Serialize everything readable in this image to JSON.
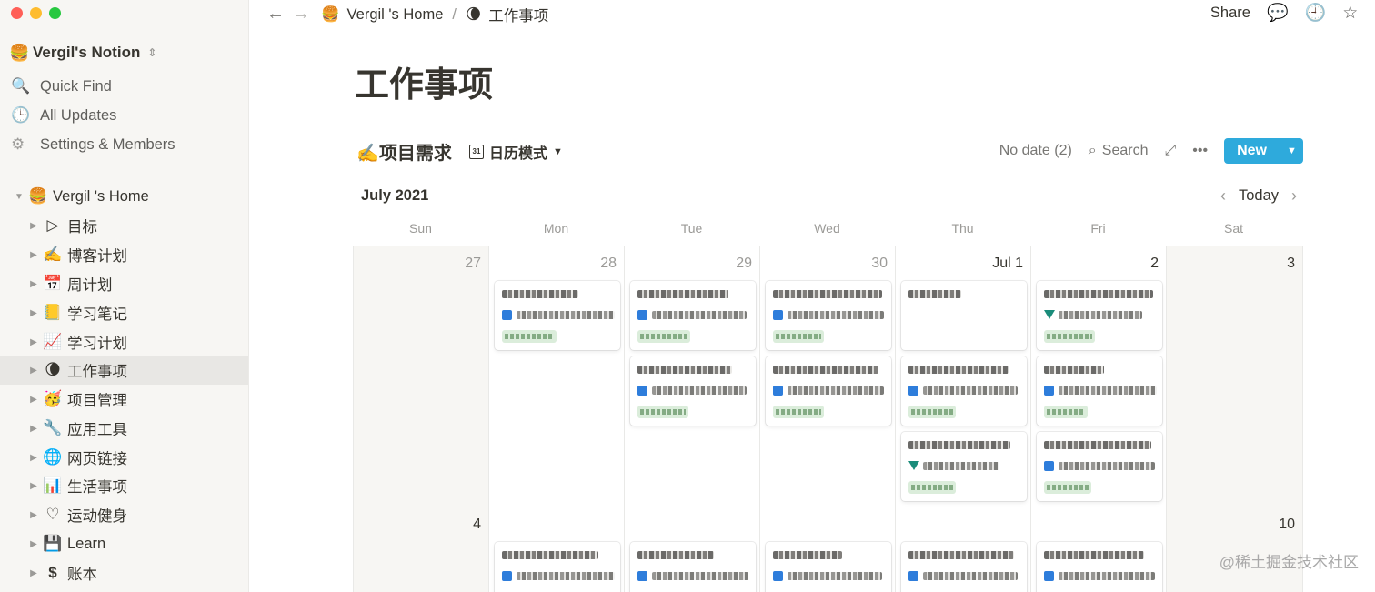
{
  "sidebar": {
    "workspace": {
      "emoji": "🍔",
      "name": "Vergil's Notion"
    },
    "nav": [
      {
        "icon": "🔍",
        "label": "Quick Find"
      },
      {
        "icon": "🕒",
        "label": "All Updates"
      },
      {
        "icon": "⚙",
        "label": "Settings & Members"
      }
    ],
    "tree": [
      {
        "icon": "🍔",
        "label": "Vergil 's Home",
        "expanded": true
      },
      {
        "icon": "▷",
        "label": "目标"
      },
      {
        "icon": "✍️",
        "label": "博客计划"
      },
      {
        "icon": "📅",
        "label": "周计划"
      },
      {
        "icon": "📒",
        "label": "学习笔记"
      },
      {
        "icon": "📈",
        "label": "学习计划"
      },
      {
        "icon": "🌘",
        "label": "工作事项",
        "selected": true
      },
      {
        "icon": "🥳",
        "label": "项目管理"
      },
      {
        "icon": "🔧",
        "label": "应用工具"
      },
      {
        "icon": "🌐",
        "label": "网页链接"
      },
      {
        "icon": "📊",
        "label": "生活事项"
      },
      {
        "icon": "♡",
        "label": "运动健身"
      },
      {
        "icon": "💾",
        "label": "Learn"
      },
      {
        "icon": "$",
        "label": "账本"
      }
    ]
  },
  "topbar": {
    "crumbs": [
      {
        "icon": "🍔",
        "label": "Vergil 's Home"
      },
      {
        "icon": "🌘",
        "label": "工作事项"
      }
    ],
    "separator": "/",
    "share": "Share"
  },
  "page": {
    "title": "工作事项",
    "db_title": "✍️项目需求",
    "view": "日历模式",
    "no_date": "No date (2)",
    "search": "Search",
    "new": "New"
  },
  "calendar": {
    "month": "July 2021",
    "today": "Today",
    "weekdays": [
      "Sun",
      "Mon",
      "Tue",
      "Wed",
      "Thu",
      "Fri",
      "Sat"
    ],
    "week1": [
      "27",
      "28",
      "29",
      "30",
      "Jul 1",
      "2",
      "3"
    ],
    "week2": [
      "4",
      "",
      "",
      "",
      "",
      "",
      "10"
    ]
  },
  "watermark": "@稀土掘金技术社区",
  "colors": {
    "accent": "#2eaadc",
    "selected_bg": "#e8e7e4",
    "sidebar_bg": "#f7f6f3",
    "tag_green": "#dbeddb"
  }
}
